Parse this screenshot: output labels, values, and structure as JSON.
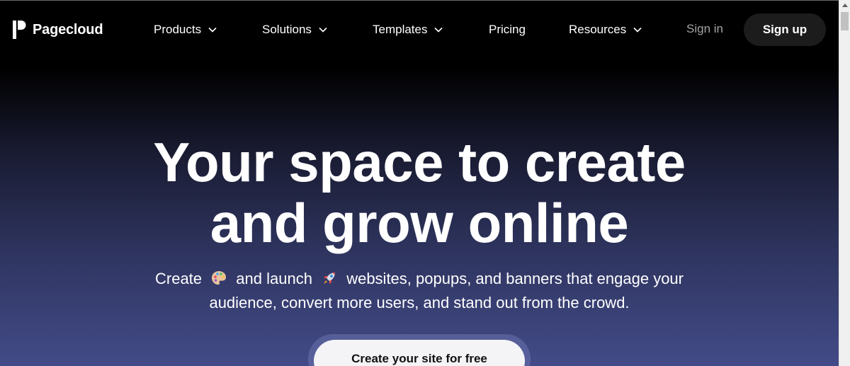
{
  "brand": {
    "name": "Pagecloud"
  },
  "nav": {
    "items": [
      {
        "label": "Products",
        "has_dropdown": true
      },
      {
        "label": "Solutions",
        "has_dropdown": true
      },
      {
        "label": "Templates",
        "has_dropdown": true
      },
      {
        "label": "Pricing",
        "has_dropdown": false
      },
      {
        "label": "Resources",
        "has_dropdown": true
      }
    ],
    "sign_in": "Sign in",
    "sign_up": "Sign up"
  },
  "hero": {
    "title_line1": "Your space to create",
    "title_line2": "and grow online",
    "subtitle": {
      "part1": "Create",
      "emoji1": "artist-palette-icon",
      "part2": "and launch",
      "emoji2": "rocket-icon",
      "part3": "websites, popups, and banners that engage your",
      "line2": "audience, convert more users, and stand out from the crowd."
    },
    "cta_label": "Create your site for free"
  },
  "colors": {
    "background_top": "#000000",
    "background_bottom": "#434b88",
    "signup_bg": "#1c1c1c",
    "signin_text": "#a3a3a3",
    "cta_bg": "#f4f4f6"
  }
}
